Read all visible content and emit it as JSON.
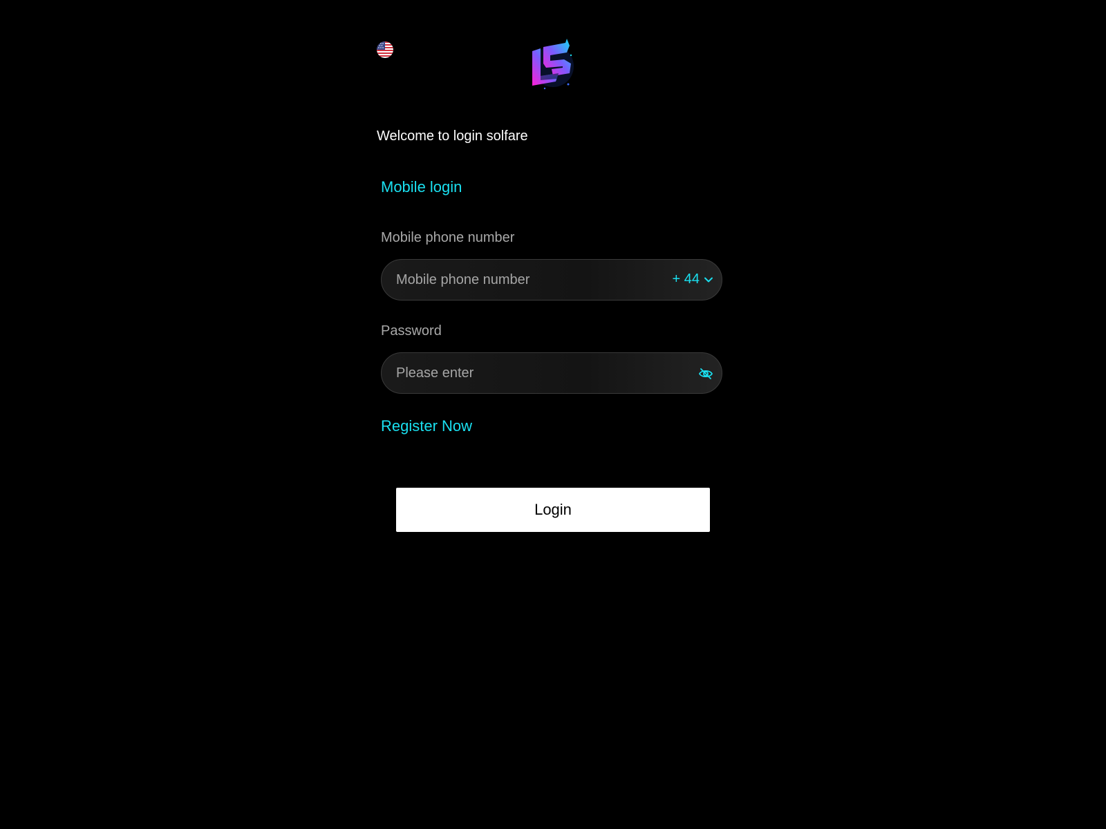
{
  "header": {
    "language_icon": "us-flag-icon",
    "logo_icon": "brand-logo-icon"
  },
  "welcome_text": "Welcome to login solfare",
  "tabs": {
    "active": "Mobile login"
  },
  "phone": {
    "label": "Mobile phone number",
    "placeholder": "Mobile phone number",
    "country_code": "+ 44",
    "dropdown_icon": "chevron-down-icon"
  },
  "password": {
    "label": "Password",
    "placeholder": "Please enter",
    "visibility_icon": "eye-off-icon"
  },
  "register_link": "Register Now",
  "login_button": "Login",
  "colors": {
    "background": "#000000",
    "accent": "#1ae0f0",
    "label": "#a9a9a9",
    "button_bg": "#ffffff"
  }
}
